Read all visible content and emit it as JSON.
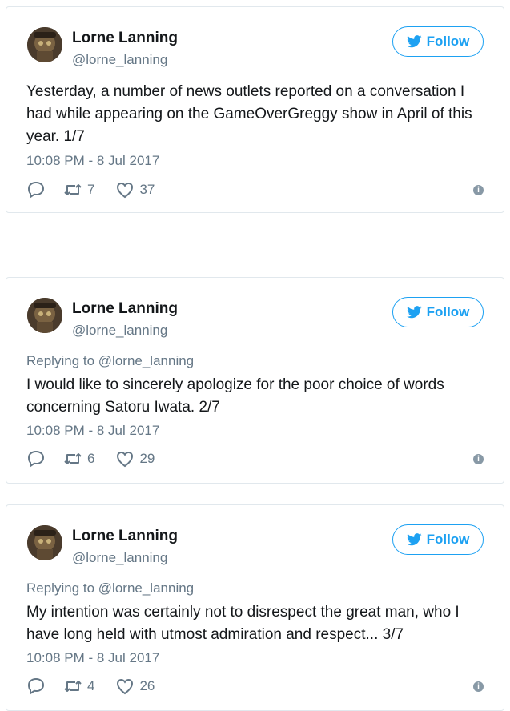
{
  "tweets": [
    {
      "name": "Lorne Lanning",
      "handle": "@lorne_lanning",
      "follow_label": "Follow",
      "reply_prefix": "",
      "reply_mention": "",
      "text": "Yesterday, a number of news outlets reported on a conversation I had while appearing on the GameOverGreggy show in April of this year. 1/7",
      "timestamp": "10:08 PM - 8 Jul 2017",
      "retweets": "7",
      "likes": "37"
    },
    {
      "name": "Lorne Lanning",
      "handle": "@lorne_lanning",
      "follow_label": "Follow",
      "reply_prefix": "Replying to",
      "reply_mention": "@lorne_lanning",
      "text": "I would like to sincerely apologize for the poor choice of words concerning Satoru Iwata. 2/7",
      "timestamp": "10:08 PM - 8 Jul 2017",
      "retweets": "6",
      "likes": "29"
    },
    {
      "name": "Lorne Lanning",
      "handle": "@lorne_lanning",
      "follow_label": "Follow",
      "reply_prefix": "Replying to",
      "reply_mention": "@lorne_lanning",
      "text": "My intention was certainly not to disrespect the great man, who I have long held with utmost admiration and respect... 3/7",
      "timestamp": "10:08 PM - 8 Jul 2017",
      "retweets": "4",
      "likes": "26"
    }
  ],
  "icons": {
    "follow": "twitter-bird-icon",
    "reply": "reply-icon",
    "retweet": "retweet-icon",
    "like": "heart-icon",
    "info": "info-icon"
  },
  "colors": {
    "accent": "#1da1f2",
    "muted": "#657786",
    "border": "#e1e8ed",
    "text": "#14171a"
  }
}
